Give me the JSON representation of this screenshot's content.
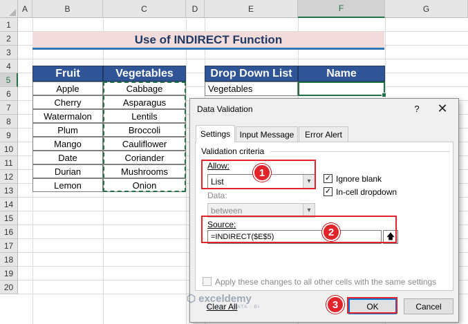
{
  "columns": [
    "A",
    "B",
    "C",
    "D",
    "E",
    "F",
    "G"
  ],
  "rows": [
    "1",
    "2",
    "3",
    "4",
    "5",
    "6",
    "7",
    "8",
    "9",
    "10",
    "11",
    "12",
    "13",
    "14",
    "15",
    "16",
    "17",
    "18",
    "19",
    "20"
  ],
  "title": "Use of INDIRECT Function",
  "table": {
    "headers": [
      "Fruit",
      "Vegetables"
    ],
    "fruits": [
      "Apple",
      "Cherry",
      "Watermalon",
      "Plum",
      "Mango",
      "Date",
      "Durian",
      "Lemon"
    ],
    "vegetables": [
      "Cabbage",
      "Asparagus",
      "Lentils",
      "Broccoli",
      "Cauliflower",
      "Coriander",
      "Mushrooms",
      "Onion"
    ]
  },
  "dropdown_table": {
    "headers": [
      "Drop Down List",
      "Name"
    ],
    "e5": "Vegetables",
    "f5": ""
  },
  "dialog": {
    "title": "Data Validation",
    "help": "?",
    "close": "✕",
    "tabs": [
      "Settings",
      "Input Message",
      "Error Alert"
    ],
    "section": "Validation criteria",
    "allow_label": "Allow:",
    "allow_value": "List",
    "ignore_blank": "Ignore blank",
    "in_cell_dropdown": "In-cell dropdown",
    "data_label": "Data:",
    "data_value": "between",
    "source_label": "Source:",
    "source_value": "=INDIRECT($E$5)",
    "apply_all": "Apply these changes to all other cells with the same settings",
    "clear_all": "Clear All",
    "ok": "OK",
    "cancel": "Cancel"
  },
  "annotations": [
    "1",
    "2",
    "3"
  ],
  "watermark": {
    "name": "exceldemy",
    "tagline": "EXCEL · DATA · BI"
  },
  "colors": {
    "header_blue": "#2f5597",
    "title_pink": "#f2dcdb",
    "excel_green": "#217346",
    "highlight_red": "#e0242a"
  }
}
